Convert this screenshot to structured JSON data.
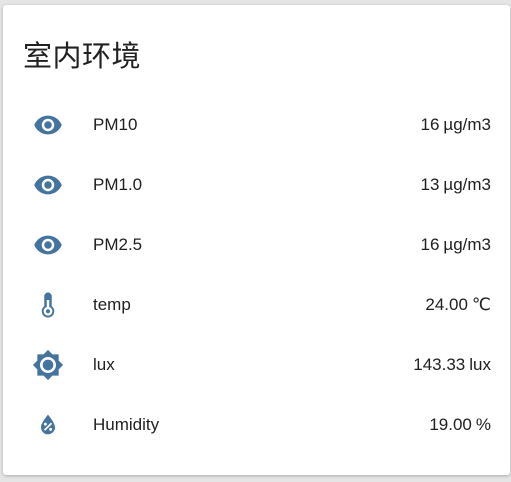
{
  "card": {
    "title": "室内环境"
  },
  "colors": {
    "icon": "#44739e",
    "text": "#212121",
    "card_bg": "#ffffff",
    "page_bg": "#e5e5e5"
  },
  "entities": [
    {
      "icon": "eye-icon",
      "name": "PM10",
      "value": "16",
      "unit": "µg/m3"
    },
    {
      "icon": "eye-icon",
      "name": "PM1.0",
      "value": "13",
      "unit": "µg/m3"
    },
    {
      "icon": "eye-icon",
      "name": "PM2.5",
      "value": "16",
      "unit": "µg/m3"
    },
    {
      "icon": "thermometer-icon",
      "name": "temp",
      "value": "24.00",
      "unit": "℃"
    },
    {
      "icon": "brightness-icon",
      "name": "lux",
      "value": "143.33",
      "unit": "lux"
    },
    {
      "icon": "water-percent-icon",
      "name": "Humidity",
      "value": "19.00",
      "unit": "%"
    }
  ]
}
